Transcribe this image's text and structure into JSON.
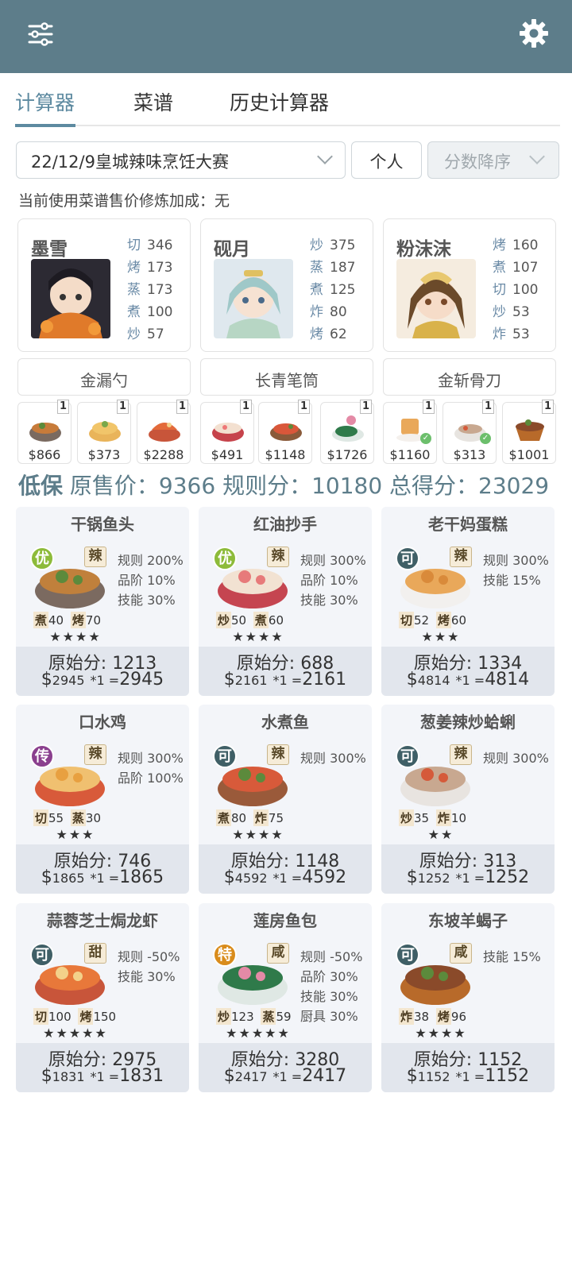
{
  "toolbar": {
    "filter_icon": "sliders-icon",
    "settings_icon": "gear-icon",
    "bar_color": "#5d7d8a"
  },
  "tabs": [
    {
      "label": "计算器",
      "active": true
    },
    {
      "label": "菜谱"
    },
    {
      "label": "历史计算器"
    }
  ],
  "filters": {
    "event": "22/12/9皇城辣味烹饪大赛",
    "mode": "个人",
    "sort": "分数降序"
  },
  "bonus_text": "当前使用菜谱售价修炼加成：无",
  "chefs": [
    {
      "name": "墨雪",
      "stats": [
        {
          "k": "切",
          "v": "346"
        },
        {
          "k": "烤",
          "v": "173"
        },
        {
          "k": "蒸",
          "v": "173"
        },
        {
          "k": "煮",
          "v": "100"
        },
        {
          "k": "炒",
          "v": "57"
        }
      ],
      "equip": "金漏勺"
    },
    {
      "name": "砚月",
      "stats": [
        {
          "k": "炒",
          "v": "375"
        },
        {
          "k": "蒸",
          "v": "187"
        },
        {
          "k": "煮",
          "v": "125"
        },
        {
          "k": "炸",
          "v": "80"
        },
        {
          "k": "烤",
          "v": "62"
        }
      ],
      "equip": "长青笔筒"
    },
    {
      "name": "粉沫沫",
      "stats": [
        {
          "k": "烤",
          "v": "160"
        },
        {
          "k": "煮",
          "v": "107"
        },
        {
          "k": "切",
          "v": "100"
        },
        {
          "k": "炒",
          "v": "53"
        },
        {
          "k": "炸",
          "v": "53"
        }
      ],
      "equip": "金斩骨刀"
    }
  ],
  "conditions": [
    {
      "badge": "1",
      "price": "$866"
    },
    {
      "badge": "1",
      "price": "$373"
    },
    {
      "badge": "1",
      "price": "$2288"
    },
    {
      "badge": "1",
      "price": "$491"
    },
    {
      "badge": "1",
      "price": "$1148"
    },
    {
      "badge": "1",
      "price": "$1726"
    },
    {
      "badge": "1",
      "price": "$1160",
      "checked": true
    },
    {
      "badge": "1",
      "price": "$313",
      "checked": true
    },
    {
      "badge": "1",
      "price": "$1001"
    }
  ],
  "summary": {
    "label": "低保",
    "text": "原售价：9366 规则分：10180 总得分：23029"
  },
  "recipes": [
    {
      "title": "干锅鱼头",
      "rarity": "优",
      "rarity_color": "#8dbb3a",
      "flavor": "辣",
      "skills": [
        {
          "k": "煮",
          "v": "40"
        },
        {
          "k": "烤",
          "v": "70"
        }
      ],
      "stars": "★★★★",
      "effects": [
        "规则 200%",
        "品阶 10%",
        "技能 30%"
      ],
      "orig": "原始分: 1213",
      "price": "2945",
      "total": "2945"
    },
    {
      "title": "红油抄手",
      "rarity": "优",
      "rarity_color": "#8dbb3a",
      "flavor": "辣",
      "skills": [
        {
          "k": "炒",
          "v": "50"
        },
        {
          "k": "煮",
          "v": "60"
        }
      ],
      "stars": "★★★★",
      "effects": [
        "规则 300%",
        "品阶 10%",
        "技能 30%"
      ],
      "orig": "原始分: 688",
      "price": "2161",
      "total": "2161"
    },
    {
      "title": "老干妈蛋糕",
      "rarity": "可",
      "rarity_color": "#3f5f66",
      "flavor": "辣",
      "skills": [
        {
          "k": "切",
          "v": "52"
        },
        {
          "k": "烤",
          "v": "60"
        }
      ],
      "stars": "★★★",
      "effects": [
        "规则 300%",
        "技能 15%"
      ],
      "orig": "原始分: 1334",
      "price": "4814",
      "total": "4814"
    },
    {
      "title": "口水鸡",
      "rarity": "传",
      "rarity_color": "#8a3f8e",
      "flavor": "辣",
      "skills": [
        {
          "k": "切",
          "v": "55"
        },
        {
          "k": "蒸",
          "v": "30"
        }
      ],
      "stars": "★★★",
      "effects": [
        "规则 300%",
        "品阶 100%"
      ],
      "orig": "原始分: 746",
      "price": "1865",
      "total": "1865"
    },
    {
      "title": "水煮鱼",
      "rarity": "可",
      "rarity_color": "#3f5f66",
      "flavor": "辣",
      "skills": [
        {
          "k": "煮",
          "v": "80"
        },
        {
          "k": "炸",
          "v": "75"
        }
      ],
      "stars": "★★★★",
      "effects": [
        "规则 300%"
      ],
      "orig": "原始分: 1148",
      "price": "4592",
      "total": "4592"
    },
    {
      "title": "葱姜辣炒蛤蜊",
      "rarity": "可",
      "rarity_color": "#3f5f66",
      "flavor": "辣",
      "skills": [
        {
          "k": "炒",
          "v": "35"
        },
        {
          "k": "炸",
          "v": "10"
        }
      ],
      "stars": "★★",
      "effects": [
        "规则 300%"
      ],
      "orig": "原始分: 313",
      "price": "1252",
      "total": "1252"
    },
    {
      "title": "蒜蓉芝士焗龙虾",
      "rarity": "可",
      "rarity_color": "#3f5f66",
      "flavor": "甜",
      "skills": [
        {
          "k": "切",
          "v": "100"
        },
        {
          "k": "烤",
          "v": "150"
        }
      ],
      "stars": "★★★★★",
      "effects": [
        "规则 -50%",
        "技能 30%"
      ],
      "orig": "原始分: 2975",
      "price": "1831",
      "total": "1831"
    },
    {
      "title": "莲房鱼包",
      "rarity": "特",
      "rarity_color": "#d98c1c",
      "flavor": "咸",
      "skills": [
        {
          "k": "炒",
          "v": "123"
        },
        {
          "k": "蒸",
          "v": "59"
        }
      ],
      "stars": "★★★★★",
      "effects": [
        "规则 -50%",
        "品阶 30%",
        "技能 30%",
        "厨具 30%"
      ],
      "orig": "原始分: 3280",
      "price": "2417",
      "total": "2417"
    },
    {
      "title": "东坡羊蝎子",
      "rarity": "可",
      "rarity_color": "#3f5f66",
      "flavor": "咸",
      "skills": [
        {
          "k": "炸",
          "v": "38"
        },
        {
          "k": "烤",
          "v": "96"
        }
      ],
      "stars": "★★★★",
      "effects": [
        "技能 15%"
      ],
      "orig": "原始分: 1152",
      "price": "1152",
      "total": "1152"
    }
  ],
  "multiplier": "*1 ="
}
